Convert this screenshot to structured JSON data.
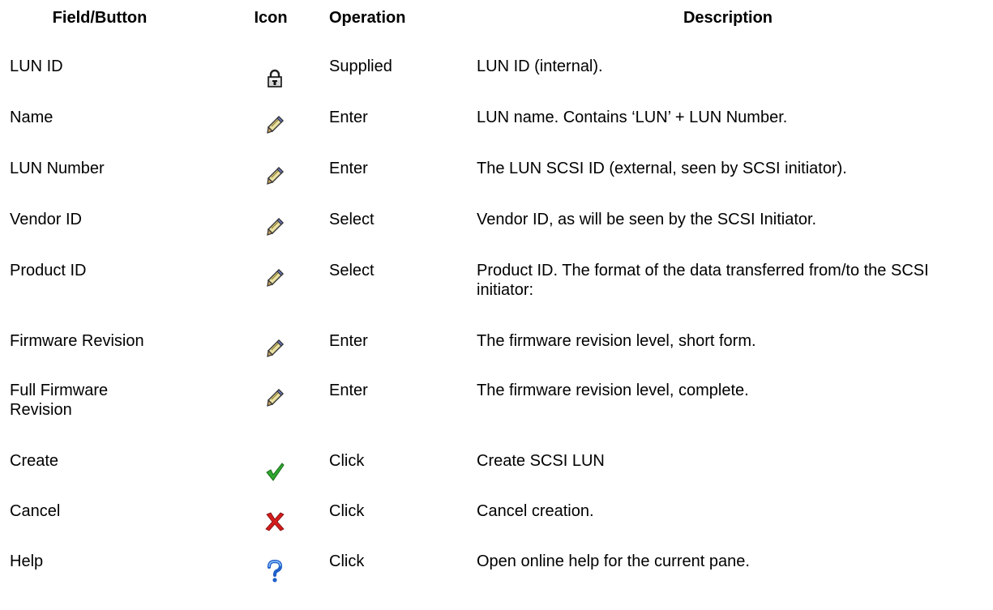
{
  "headers": {
    "field": "Field/Button",
    "icon": "Icon",
    "operation": "Operation",
    "description": "Description"
  },
  "rows": [
    {
      "field": "LUN ID",
      "icon": "lock-icon",
      "operation": "Supplied",
      "description": "LUN ID (internal)."
    },
    {
      "field": "Name",
      "icon": "pencil-icon",
      "operation": "Enter",
      "description": "LUN name. Contains ‘LUN’ + LUN Number."
    },
    {
      "field": "LUN Number",
      "icon": "pencil-icon",
      "operation": "Enter",
      "description": "The LUN SCSI ID (external, seen by SCSI initiator)."
    },
    {
      "field": "Vendor ID",
      "icon": "pencil-icon",
      "operation": "Select",
      "description": "Vendor ID, as will be seen by the SCSI Initiator."
    },
    {
      "field": "Product ID",
      "icon": "pencil-icon",
      "operation": "Select",
      "description": "Product ID. The format of the data transferred from/to the SCSI initiator:"
    },
    {
      "field": "Firmware Revision",
      "icon": "pencil-icon",
      "operation": "Enter",
      "description": "The firmware revision level, short form."
    },
    {
      "field": "Full Firmware Revision",
      "icon": "pencil-icon",
      "operation": "Enter",
      "description": "The firmware revision level, complete."
    },
    {
      "field": "Create",
      "icon": "checkmark-icon",
      "operation": "Click",
      "description": "Create SCSI LUN"
    },
    {
      "field": "Cancel",
      "icon": "x-icon",
      "operation": "Click",
      "description": "Cancel creation."
    },
    {
      "field": "Help",
      "icon": "question-mark-icon",
      "operation": "Click",
      "description": "Open online help for the current pane."
    }
  ]
}
